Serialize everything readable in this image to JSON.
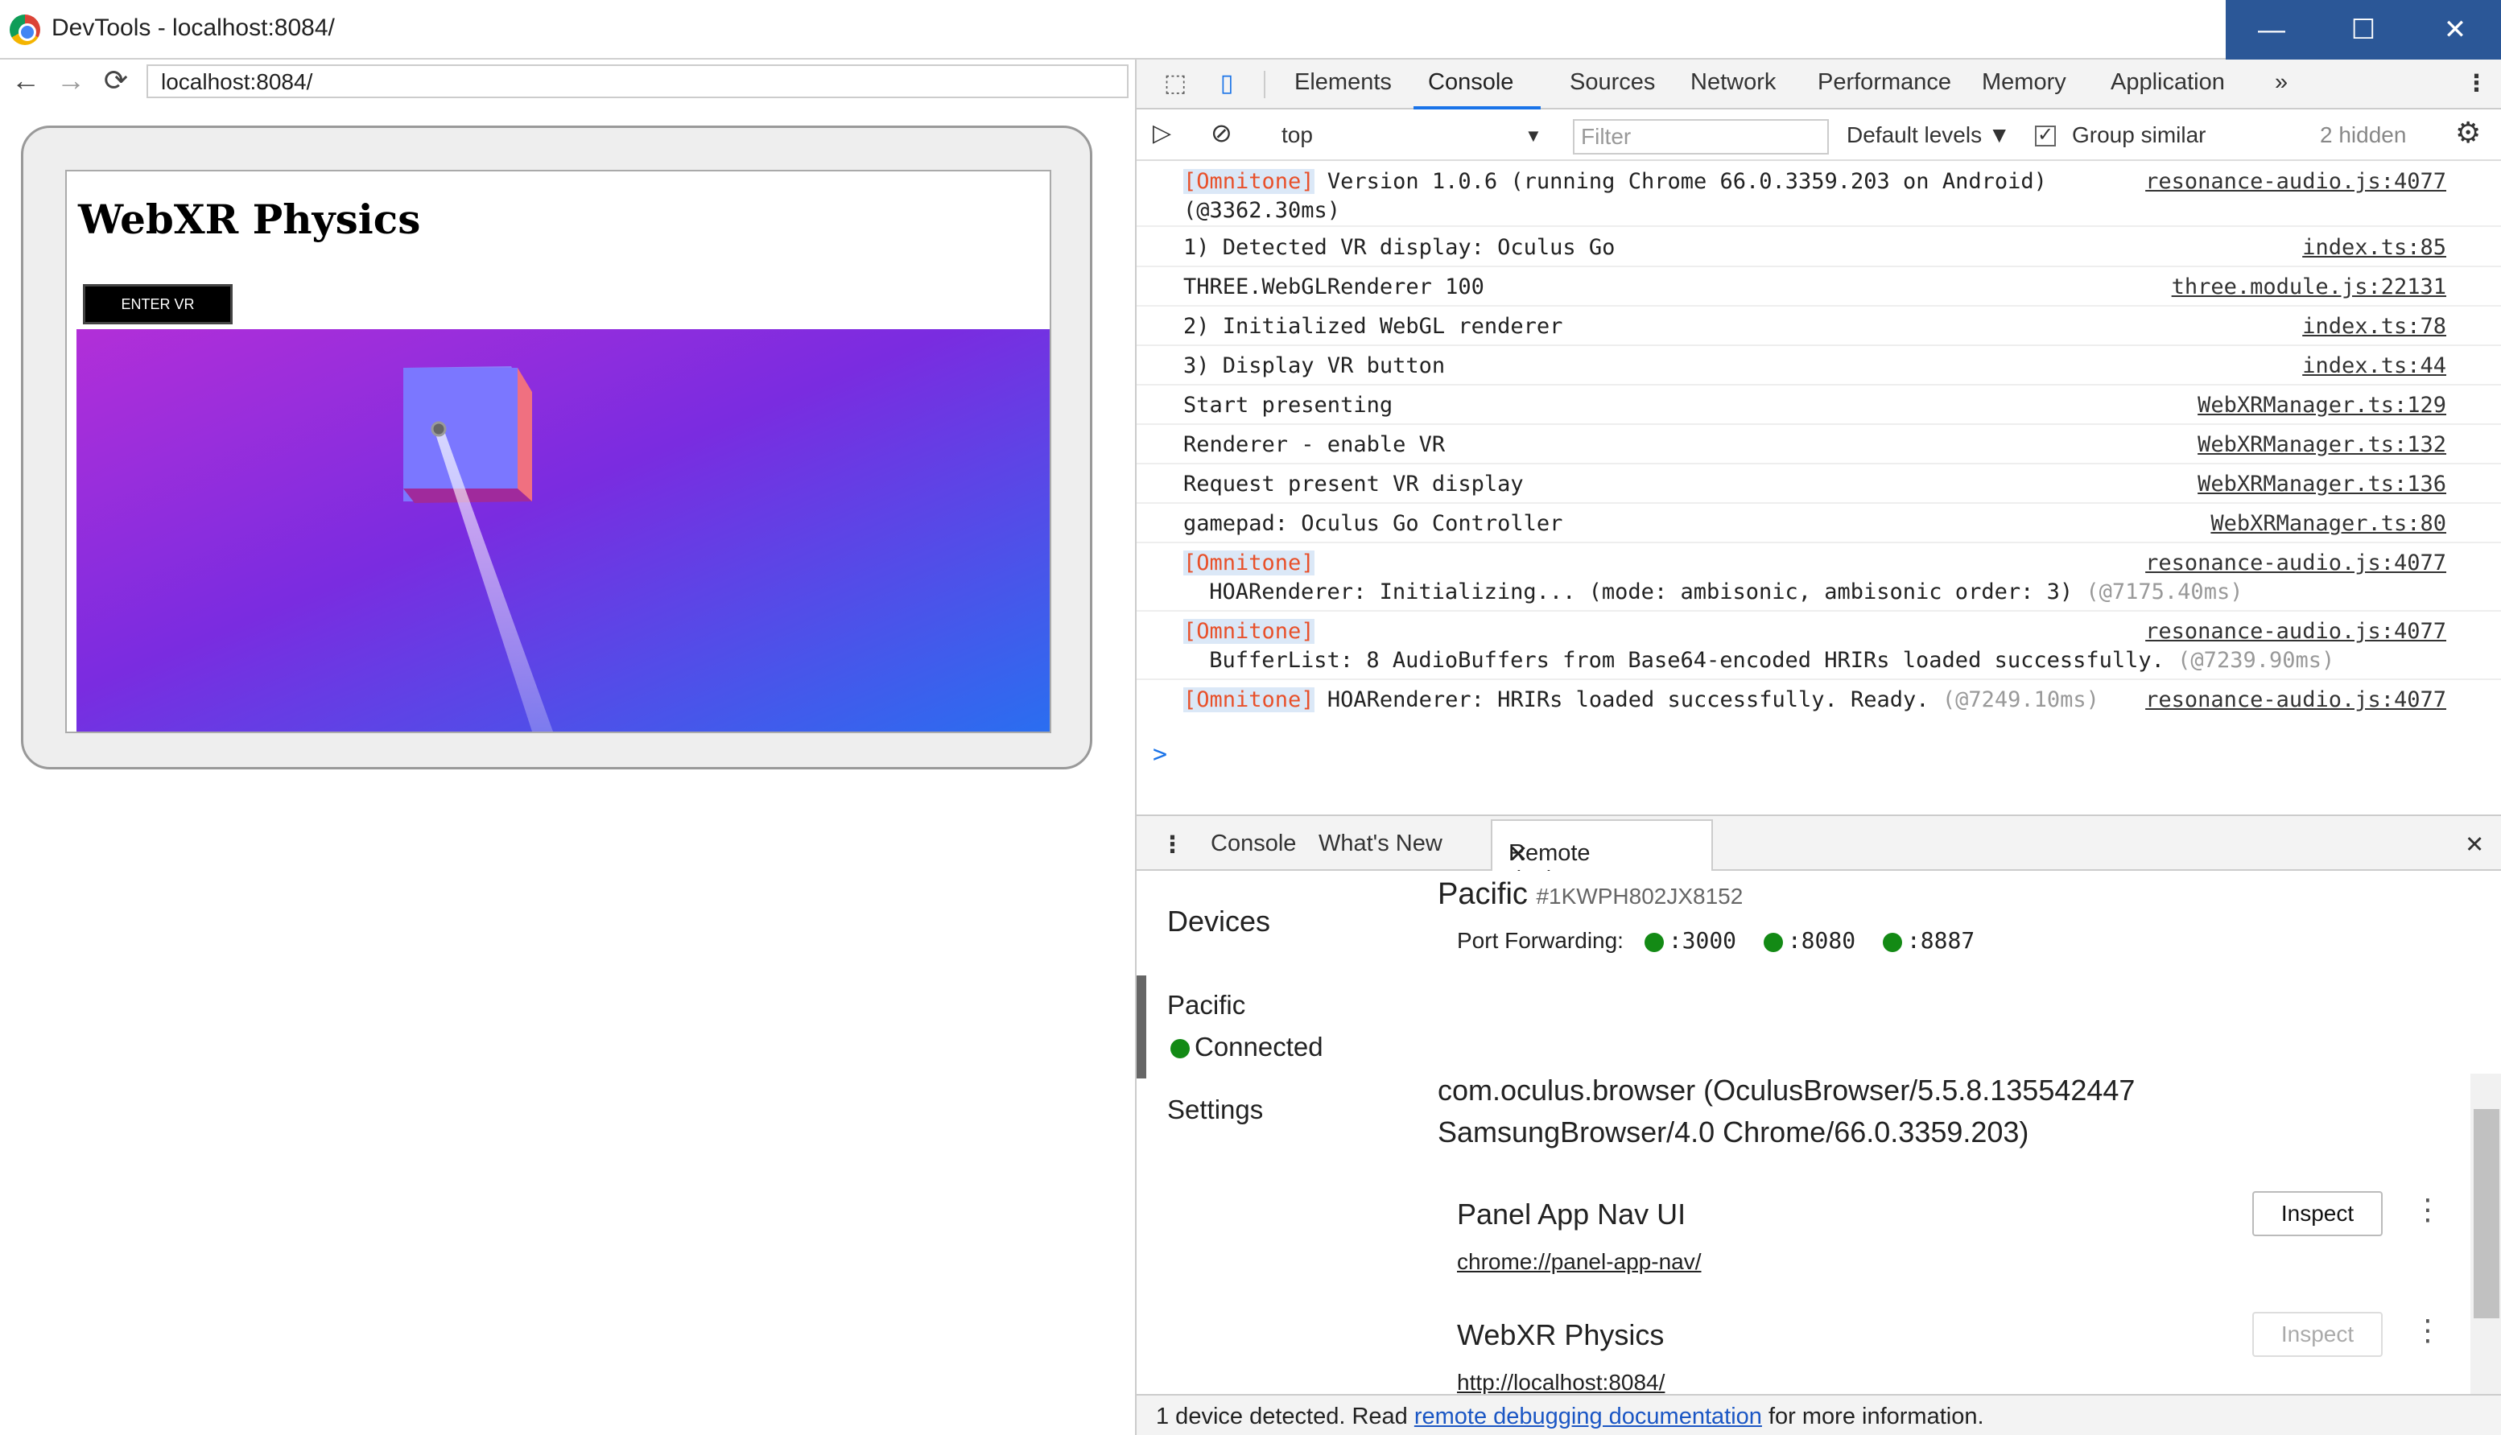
{
  "window": {
    "title": "DevTools - localhost:8084/",
    "minimize": "—",
    "maximize": "☐",
    "close": "✕"
  },
  "browser": {
    "back": "←",
    "forward": "→",
    "reload": "⟳",
    "url": "localhost:8084/",
    "page_title": "WebXR Physics",
    "enter_vr": "ENTER VR"
  },
  "devtools": {
    "tabs": [
      "Elements",
      "Console",
      "Sources",
      "Network",
      "Performance",
      "Memory",
      "Application"
    ],
    "active_tab": "Console",
    "more": "»",
    "console_toolbar": {
      "context": "top",
      "filter_placeholder": "Filter",
      "levels": "Default levels ▼",
      "group_similar": "Group similar",
      "hidden": "2 hidden"
    },
    "console_lines": [
      {
        "tag": "[Omnitone]",
        "msg": " Version 1.0.6 (running Chrome 66.0.3359.203 on Android)",
        "ts": "(@3362.30ms)",
        "src": "resonance-audio.js:4077"
      },
      {
        "msg": "1) Detected VR display: Oculus Go",
        "src": "index.ts:85"
      },
      {
        "msg": "THREE.WebGLRenderer 100",
        "src": "three.module.js:22131"
      },
      {
        "msg": "2) Initialized WebGL renderer",
        "src": "index.ts:78"
      },
      {
        "msg": "3) Display VR button",
        "src": "index.ts:44"
      },
      {
        "msg": "Start presenting",
        "src": "WebXRManager.ts:129"
      },
      {
        "msg": "Renderer - enable VR",
        "src": "WebXRManager.ts:132"
      },
      {
        "msg": "Request present VR display",
        "src": "WebXRManager.ts:136"
      },
      {
        "msg": "gamepad: Oculus Go Controller",
        "src": "WebXRManager.ts:80"
      },
      {
        "tag": "[Omnitone]",
        "msg": " HOARenderer: Initializing... (mode: ambisonic, ambisonic order: 3)",
        "ts": "(@7175.40ms)",
        "src": "resonance-audio.js:4077"
      },
      {
        "tag": "[Omnitone]",
        "msg": " BufferList: 8 AudioBuffers from Base64-encoded HRIRs loaded successfully.",
        "ts": "(@7239.90ms)",
        "src": "resonance-audio.js:4077"
      },
      {
        "tag": "[Omnitone]",
        "msg": " HOARenderer: HRIRs loaded successfully. Ready.",
        "ts": "(@7249.10ms)",
        "src": "resonance-audio.js:4077"
      }
    ],
    "prompt": ">",
    "drawer_tabs": [
      "Console",
      "What's New",
      "Remote devices"
    ],
    "drawer_close": "✕",
    "remote": {
      "sidebar_title": "Devices",
      "device_name": "Pacific",
      "device_status": "Connected",
      "settings": "Settings",
      "device_header": "Pacific",
      "serial": "#1KWPH802JX8152",
      "port_forwarding_label": "Port Forwarding:",
      "ports": [
        ":3000",
        ":8080",
        ":8887"
      ],
      "browser_line1": "com.oculus.browser (OculusBrowser/5.5.8.135542447",
      "browser_line2": "SamsungBrowser/4.0 Chrome/66.0.3359.203)",
      "targets": [
        {
          "title": "Panel App Nav UI",
          "url": "chrome://panel-app-nav/",
          "inspect": "Inspect"
        },
        {
          "title": "WebXR Physics",
          "url": "http://localhost:8084/",
          "inspect": "Inspect"
        }
      ]
    },
    "status": {
      "prefix": "1 device detected. Read ",
      "link": "remote debugging documentation",
      "suffix": " for more information."
    }
  }
}
